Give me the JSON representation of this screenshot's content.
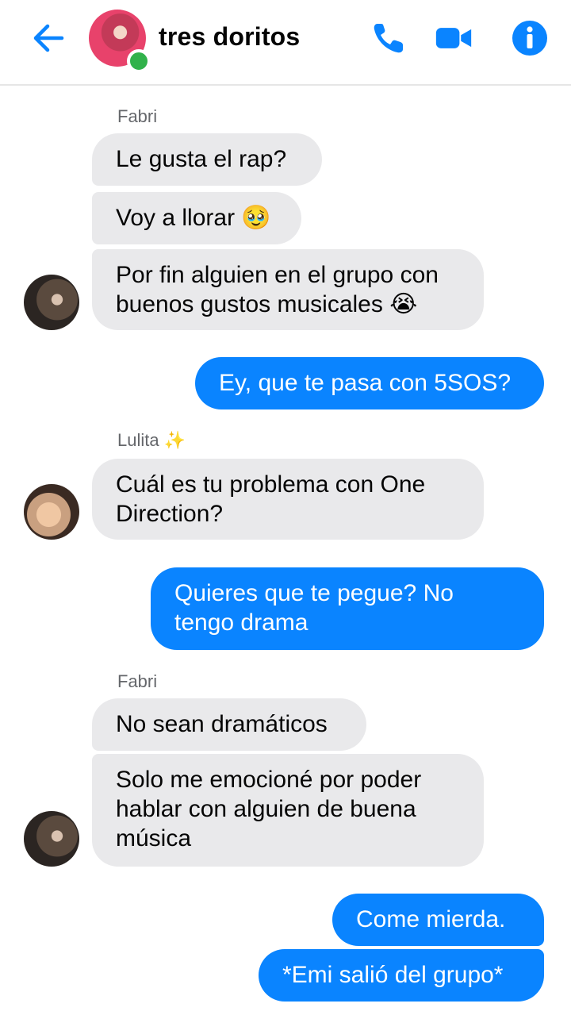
{
  "header": {
    "title": "tres doritos",
    "icons": [
      "back-arrow-icon",
      "phone-icon",
      "video-camera-icon",
      "info-icon"
    ],
    "accent_color": "#0a84ff"
  },
  "messages": {
    "fabri_name": "Fabri",
    "m1": "Le gusta el rap?",
    "m2": "Voy a llorar 🥹",
    "m3": "Por fin alguien en el grupo con\nbuenos gustos musicales 😭",
    "m4": "Ey, que te pasa con 5SOS?",
    "lulita_name": "Lulita ✨",
    "m5": "Cuál es tu problema con One\nDirection?",
    "m6": "Quieres que te pegue? No\ntengo drama",
    "fabri_name_2": "Fabri",
    "m7": "No sean dramáticos",
    "m8": "Solo me emocioné por poder\nhablar con alguien de buena\nmúsica",
    "m9": "Come mierda.",
    "m10": "*Emi salió del grupo*"
  }
}
